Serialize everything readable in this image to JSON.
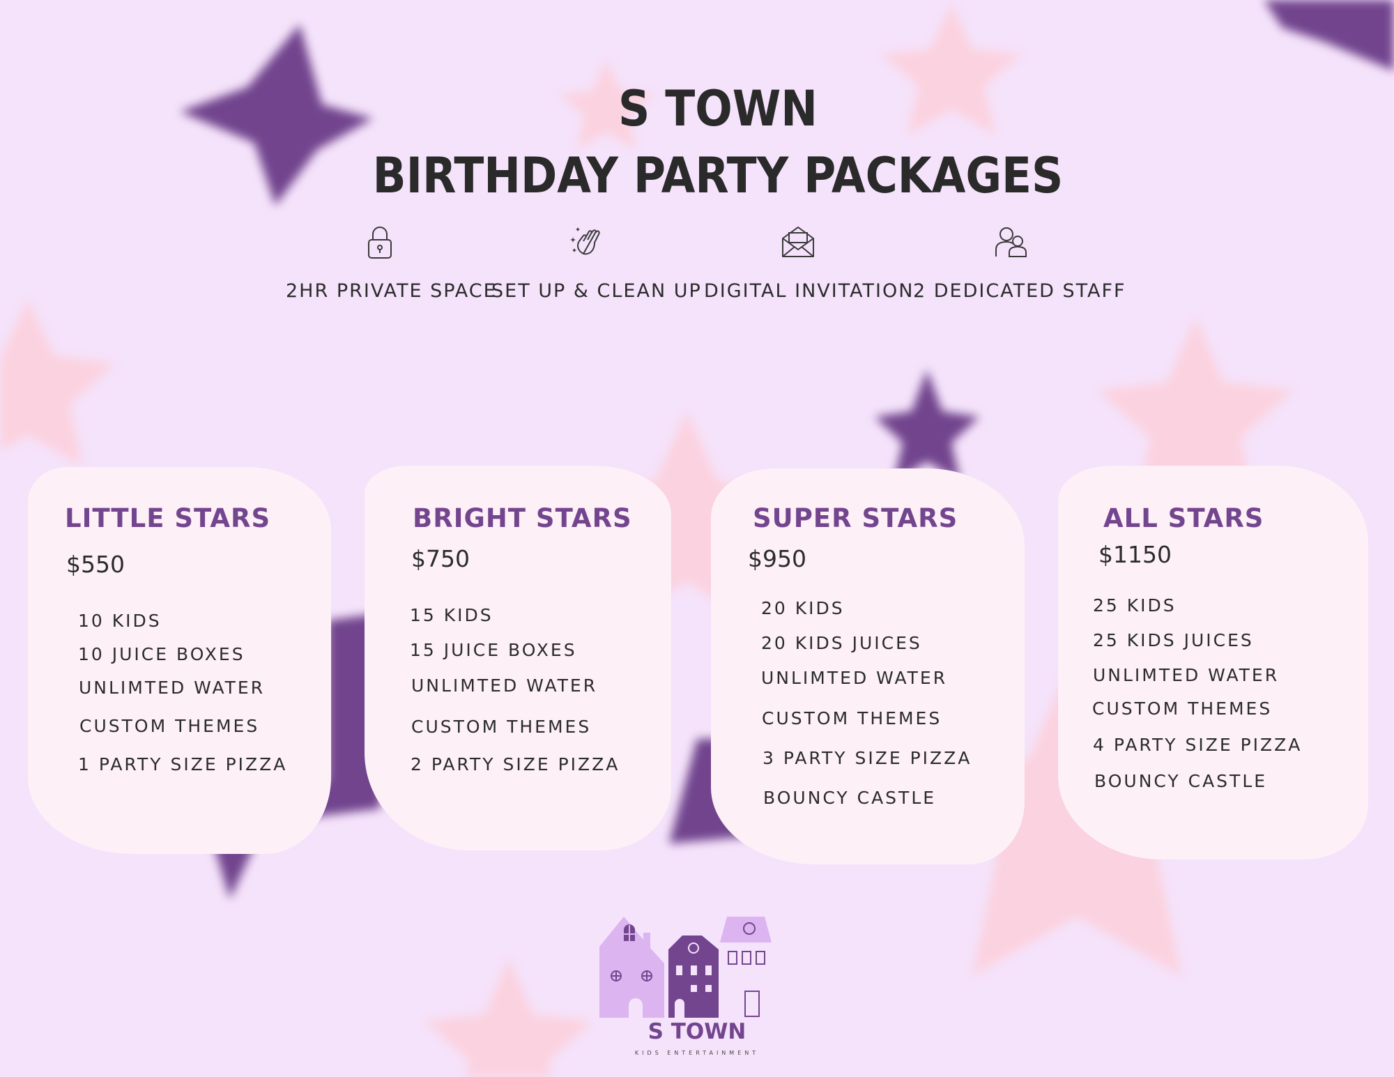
{
  "header": {
    "title_line1": "S TOWN",
    "title_line2": "BIRTHDAY PARTY PACKAGES"
  },
  "features": [
    {
      "icon": "lock-icon",
      "label": "2HR PRIVATE SPACE"
    },
    {
      "icon": "cleaning-hand-icon",
      "label": "SET UP & CLEAN UP"
    },
    {
      "icon": "envelope-icon",
      "label": "DIGITAL INVITATION"
    },
    {
      "icon": "people-icon",
      "label": "2 DEDICATED STAFF"
    }
  ],
  "packages": [
    {
      "name": "LITTLE STARS",
      "price": "$550",
      "items": [
        "10 KIDS",
        "10 JUICE BOXES",
        "UNLIMTED WATER",
        "CUSTOM THEMES",
        "1 PARTY SIZE PIZZA"
      ]
    },
    {
      "name": "BRIGHT STARS",
      "price": "$750",
      "items": [
        "15 KIDS",
        "15 JUICE BOXES",
        "UNLIMTED WATER",
        "CUSTOM THEMES",
        "2 PARTY SIZE PIZZA"
      ]
    },
    {
      "name": "SUPER STARS",
      "price": "$950",
      "items": [
        "20 KIDS",
        "20 KIDS JUICES",
        "UNLIMTED WATER",
        "CUSTOM THEMES",
        "3 PARTY SIZE PIZZA",
        "BOUNCY CASTLE"
      ]
    },
    {
      "name": "ALL STARS",
      "price": "$1150",
      "items": [
        "25 KIDS",
        "25 KIDS JUICES",
        "UNLIMTED WATER",
        "CUSTOM THEMES",
        "4 PARTY SIZE PIZZA",
        "BOUNCY CASTLE"
      ]
    }
  ],
  "logo": {
    "name": "S TOWN",
    "tagline": "KIDS ENTERTAINMENT"
  },
  "colors": {
    "background": "#f5e3fb",
    "accent_purple": "#73458f",
    "star_pink": "#fbcfdc",
    "card": "#fdf1f7",
    "text": "#2b2b2b"
  }
}
